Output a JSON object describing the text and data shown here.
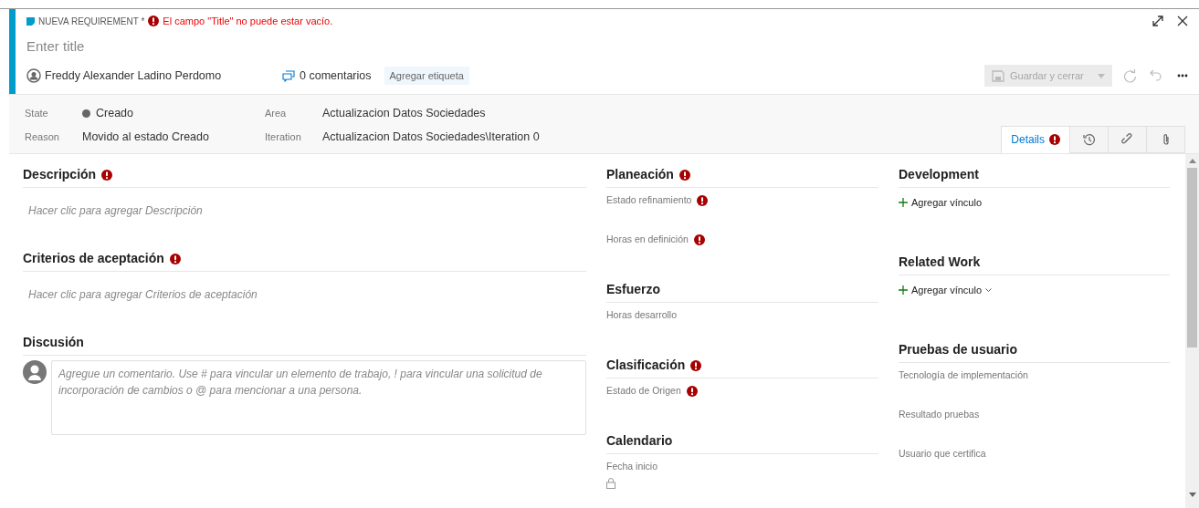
{
  "header": {
    "work_item_type": "NUEVA REQUIREMENT *",
    "error": "El campo \"Title\" no puede estar vacío.",
    "title_placeholder": "Enter title",
    "author": "Freddy Alexander Ladino Perdomo",
    "comments": "0 comentarios",
    "tag_button": "Agregar etiqueta"
  },
  "toolbar": {
    "save_label": "Guardar y cerrar",
    "save_disabled": true
  },
  "fields": {
    "state_label": "State",
    "state": "Creado",
    "reason_label": "Reason",
    "reason": "Movido al estado Creado",
    "area_label": "Area",
    "area": "Actualizacion Datos Sociedades",
    "iteration_label": "Iteration",
    "iteration": "Actualizacion Datos Sociedades\\Iteration 0"
  },
  "tabs": [
    {
      "kind": "text",
      "label": "Details",
      "selected": true,
      "error": true
    },
    {
      "kind": "history",
      "selected": false,
      "error": false
    },
    {
      "kind": "links",
      "selected": false,
      "error": false
    },
    {
      "kind": "attachments",
      "selected": false,
      "error": false
    }
  ],
  "columns": [
    [
      {
        "kind": "richtext",
        "title": "Descripción",
        "required": true,
        "placeholder": "Hacer clic para agregar Descripción"
      },
      {
        "kind": "richtext",
        "title": "Criterios de aceptación",
        "required": true,
        "placeholder": "Hacer clic para agregar Criterios de aceptación"
      },
      {
        "kind": "discussion",
        "title": "Discusión",
        "required": false,
        "placeholder": "Agregue un comentario. Use # para vincular un elemento de trabajo, ! para vincular una solicitud de incorporación de cambios o @ para mencionar a una persona."
      }
    ],
    [
      {
        "kind": "fields",
        "title": "Planeación",
        "required": true,
        "fields": [
          {
            "label": "Estado refinamiento",
            "required": true,
            "locked": false
          },
          {
            "label": "Horas en definición",
            "required": true,
            "locked": false
          }
        ]
      },
      {
        "kind": "fields",
        "title": "Esfuerzo",
        "required": false,
        "fields": [
          {
            "label": "Horas desarrollo",
            "required": false,
            "locked": false
          }
        ]
      },
      {
        "kind": "fields",
        "title": "Clasificación",
        "required": true,
        "fields": [
          {
            "label": "Estado de Origen",
            "required": true,
            "locked": false
          }
        ]
      },
      {
        "kind": "fields",
        "title": "Calendario",
        "required": false,
        "fields": [
          {
            "label": "Fecha inicio",
            "required": false,
            "locked": true
          }
        ]
      }
    ],
    [
      {
        "kind": "links",
        "title": "Development",
        "required": false,
        "link_label": "Agregar vínculo",
        "dropdown": false
      },
      {
        "kind": "links",
        "title": "Related Work",
        "required": false,
        "link_label": "Agregar vínculo",
        "dropdown": true
      },
      {
        "kind": "fields",
        "title": "Pruebas de usuario",
        "required": false,
        "fields": [
          {
            "label": "Tecnología de implementación",
            "required": false,
            "locked": false
          },
          {
            "label": "Resultado pruebas",
            "required": false,
            "locked": false
          },
          {
            "label": "Usuario que certifica",
            "required": false,
            "locked": false
          }
        ]
      }
    ]
  ]
}
